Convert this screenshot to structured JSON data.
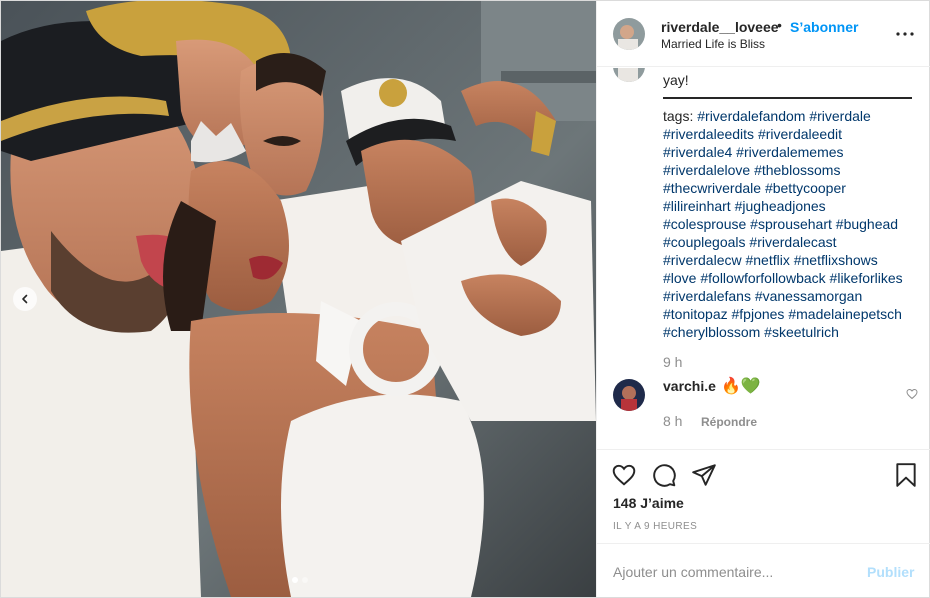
{
  "post": {
    "photo_alt": "",
    "carousel": {
      "dot_count": 2,
      "active_index": 0
    }
  },
  "header": {
    "username": "riverdale__loveee",
    "separator": "•",
    "follow_label": "S’abonner",
    "subtitle": "Married Life is Bliss"
  },
  "caption": {
    "lines": [
      "yay!",
      "tags: ",
      ""
    ],
    "first_line": "yay!",
    "tags_prefix": "tags: ",
    "hashtag_lines": [
      [
        "#riverdalefandom",
        "#riverdale"
      ],
      [
        "#riverdaleedits",
        "#riverdaleedit"
      ],
      [
        "#riverdale4",
        "#riverdalememes"
      ],
      [
        "#riverdalelove",
        "#theblossoms"
      ],
      [
        "#thecwriverdale",
        "#bettycooper"
      ],
      [
        "#lilireinhart",
        "#jugheadjones"
      ],
      [
        "#colesprouse",
        "#sprousehart",
        "#bughead"
      ],
      [
        "#couplegoals",
        "#riverdalecast"
      ],
      [
        "#riverdalecw",
        "#netflix",
        "#netflixshows"
      ],
      [
        "#love",
        "#followforfollowback",
        "#likeforlikes"
      ],
      [
        "#riverdalefans",
        "#vanessamorgan"
      ],
      [
        "#tonitopaz",
        "#fpjones",
        "#madelainepetsch"
      ],
      [
        "#cherylblossom",
        "#skeetulrich"
      ]
    ],
    "time": "9 h"
  },
  "comment": {
    "username": "varchi.e",
    "text": "🔥💚",
    "time": "8 h",
    "reply_label": "Répondre"
  },
  "actions": {
    "like_icon": "heart-icon",
    "comment_icon": "comment-icon",
    "share_icon": "share-icon",
    "save_icon": "bookmark-icon",
    "likes_label": "148 J’aime",
    "posted_ago": "IL Y A 9 HEURES"
  },
  "add_comment": {
    "placeholder": "Ajouter un commentaire...",
    "publish_label": "Publier"
  },
  "colors": {
    "link_blue": "#0095f6",
    "hashtag_blue": "#00376b",
    "muted_gray": "#8e8e8e",
    "publish_disabled": "#b2dffc",
    "border": "#dbdbdb"
  }
}
